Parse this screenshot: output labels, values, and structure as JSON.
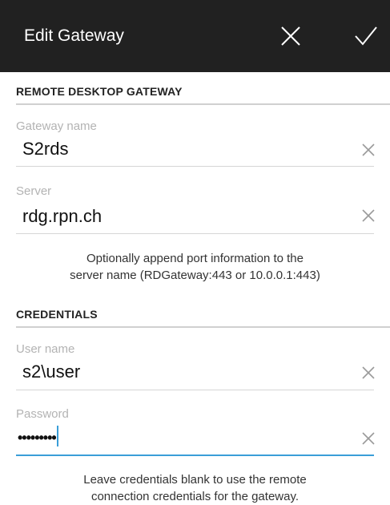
{
  "appbar": {
    "title": "Edit Gateway",
    "cancel_icon": "close-icon",
    "confirm_icon": "check-icon",
    "background": "#212121"
  },
  "gateway_section": {
    "header": "REMOTE DESKTOP GATEWAY",
    "gateway_name": {
      "label": "Gateway name",
      "value": "S2rds"
    },
    "server": {
      "label": "Server",
      "value": "rdg.rpn.ch"
    },
    "hint": [
      "Optionally append port information to the",
      "server name (RDGateway:443 or 10.0.0.1:443)"
    ]
  },
  "credentials_section": {
    "header": "CREDENTIALS",
    "user_name": {
      "label": "User name",
      "value": "s2\\user"
    },
    "password": {
      "label": "Password",
      "value": "•••••••••"
    },
    "hint": [
      "Leave credentials blank to use the remote",
      "connection credentials for the gateway."
    ]
  },
  "colors": {
    "accent": "#3a9ed8",
    "label_gray": "#b3b3b3",
    "divider": "#d0d0d0"
  }
}
